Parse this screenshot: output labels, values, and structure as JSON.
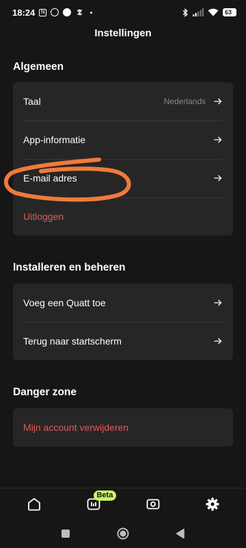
{
  "status_bar": {
    "time": "18:24",
    "notification_icons": [
      "nfc-icon",
      "whatsapp-icon",
      "news-icon",
      "nyt-icon"
    ],
    "battery": "63"
  },
  "header": {
    "title": "Instellingen"
  },
  "sections": {
    "general": {
      "title": "Algemeen",
      "language_label": "Taal",
      "language_value": "Nederlands",
      "app_info_label": "App-informatie",
      "email_label": "E-mail adres",
      "logout_label": "Uitloggen"
    },
    "install": {
      "title": "Installeren en beheren",
      "add_quatt_label": "Voeg een Quatt toe",
      "back_home_label": "Terug naar startscherm"
    },
    "danger": {
      "title": "Danger zone",
      "delete_account_label": "Mijn account verwijderen"
    }
  },
  "bottom_nav": {
    "items": [
      "home-icon",
      "insights-icon",
      "device-icon",
      "settings-icon"
    ],
    "beta_badge": "Beta"
  },
  "colors": {
    "background": "#161616",
    "card": "#262626",
    "danger_text": "#e35a5a",
    "beta_badge": "#c6f56a",
    "annotation": "#f07a3c"
  }
}
